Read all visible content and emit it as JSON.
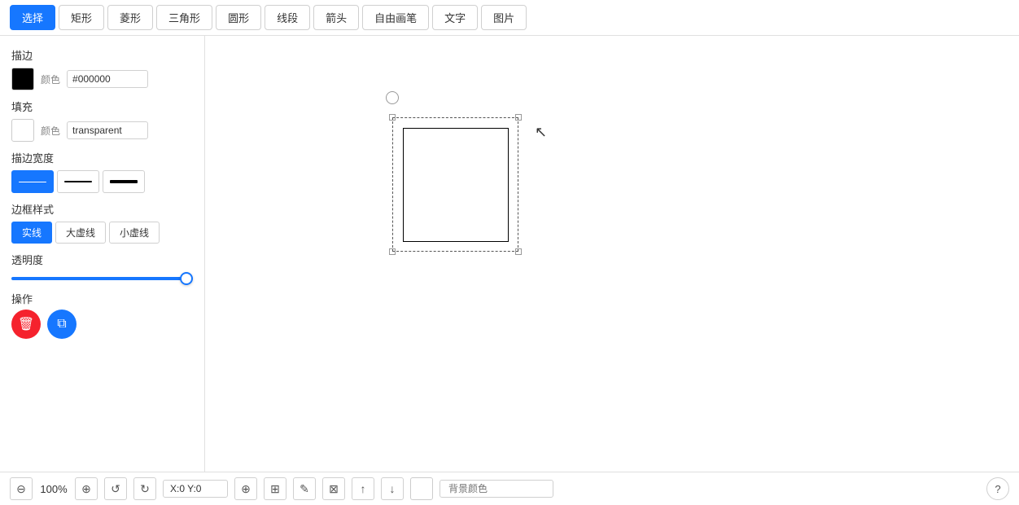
{
  "toolbar": {
    "tools": [
      {
        "id": "select",
        "label": "选择",
        "active": true
      },
      {
        "id": "rect",
        "label": "矩形",
        "active": false
      },
      {
        "id": "diamond",
        "label": "菱形",
        "active": false
      },
      {
        "id": "triangle",
        "label": "三角形",
        "active": false
      },
      {
        "id": "circle",
        "label": "圆形",
        "active": false
      },
      {
        "id": "line",
        "label": "线段",
        "active": false
      },
      {
        "id": "arrow",
        "label": "箭头",
        "active": false
      },
      {
        "id": "freehand",
        "label": "自由画笔",
        "active": false
      },
      {
        "id": "text",
        "label": "文字",
        "active": false
      },
      {
        "id": "image",
        "label": "图片",
        "active": false
      }
    ]
  },
  "left_panel": {
    "stroke_label": "描边",
    "stroke_color_label": "颜色",
    "stroke_color_value": "#000000",
    "fill_label": "填充",
    "fill_color_label": "颜色",
    "fill_color_value": "transparent",
    "stroke_width_label": "描边宽度",
    "border_style_label": "边框样式",
    "border_style_buttons": [
      {
        "id": "solid",
        "label": "实线",
        "active": true
      },
      {
        "id": "large-dash",
        "label": "大虚线",
        "active": false
      },
      {
        "id": "small-dash",
        "label": "小虚线",
        "active": false
      }
    ],
    "opacity_label": "透明度",
    "opacity_value": 100,
    "operation_label": "操作",
    "delete_title": "删除",
    "copy_title": "复制"
  },
  "canvas": {
    "shape_border": "dashed"
  },
  "bottom_toolbar": {
    "zoom_out_label": "−",
    "zoom_value": "100%",
    "zoom_in_label": "+",
    "undo_label": "↺",
    "redo_label": "↻",
    "coord_display": "X:0 Y:0",
    "align_label": "⊕",
    "grid_label": "⊞",
    "edit_label": "✎",
    "delete_label": "⊠",
    "upload_label": "↑",
    "download_label": "↓",
    "bg_color_placeholder": "背景颜色",
    "help_label": "?"
  }
}
